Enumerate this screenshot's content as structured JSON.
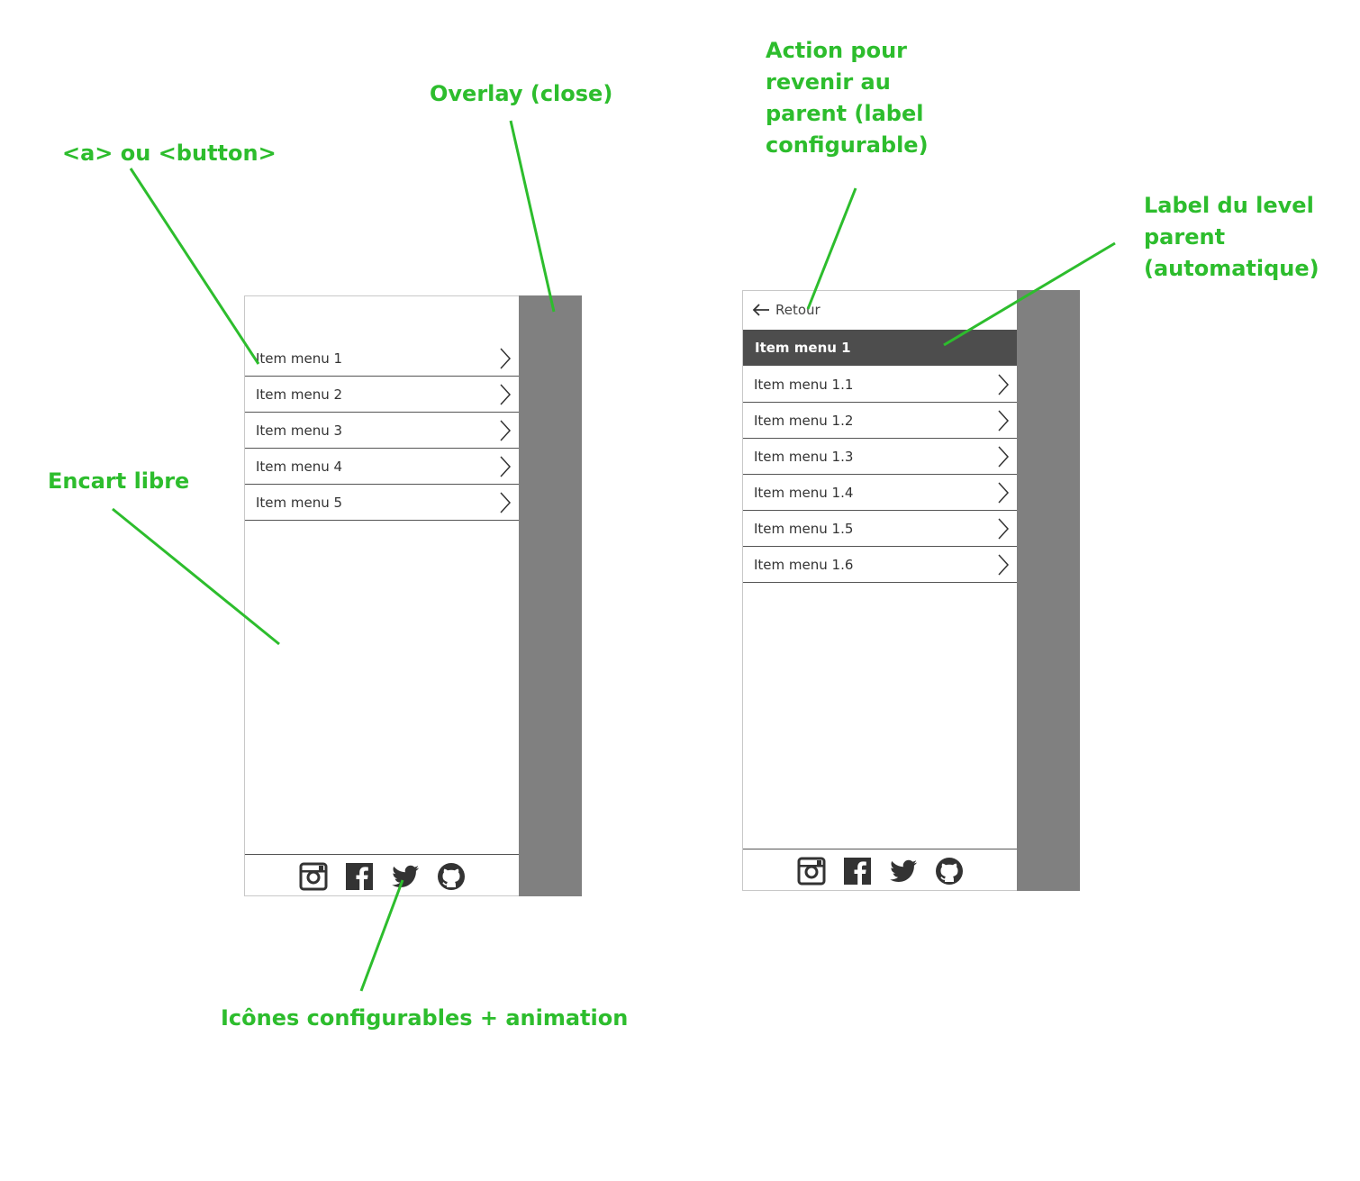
{
  "annotations": {
    "overlay": "Overlay (close)",
    "a_button": "<a> ou <button>",
    "encart": "Encart libre",
    "icones": "Icônes configurables + animation",
    "action_parent": "Action pour\nrevenir au\nparent (label\nconfigurable)",
    "label_level": "Label du level\nparent\n(automatique)"
  },
  "menu_level1": {
    "items": [
      "Item menu 1",
      "Item menu 2",
      "Item menu 3",
      "Item menu 4",
      "Item menu 5"
    ]
  },
  "menu_level2": {
    "back_label": "Retour",
    "parent_label": "Item menu 1",
    "items": [
      "Item menu 1.1",
      "Item menu 1.2",
      "Item menu 1.3",
      "Item menu 1.4",
      "Item menu 1.5",
      "Item menu 1.6"
    ]
  },
  "social_icons": [
    "instagram-icon",
    "facebook-icon",
    "twitter-icon",
    "github-icon"
  ],
  "colors": {
    "annotation": "#2dbd2d",
    "overlay": "#808080",
    "parent_label_bg": "#4d4d4d",
    "icon": "#333333"
  }
}
